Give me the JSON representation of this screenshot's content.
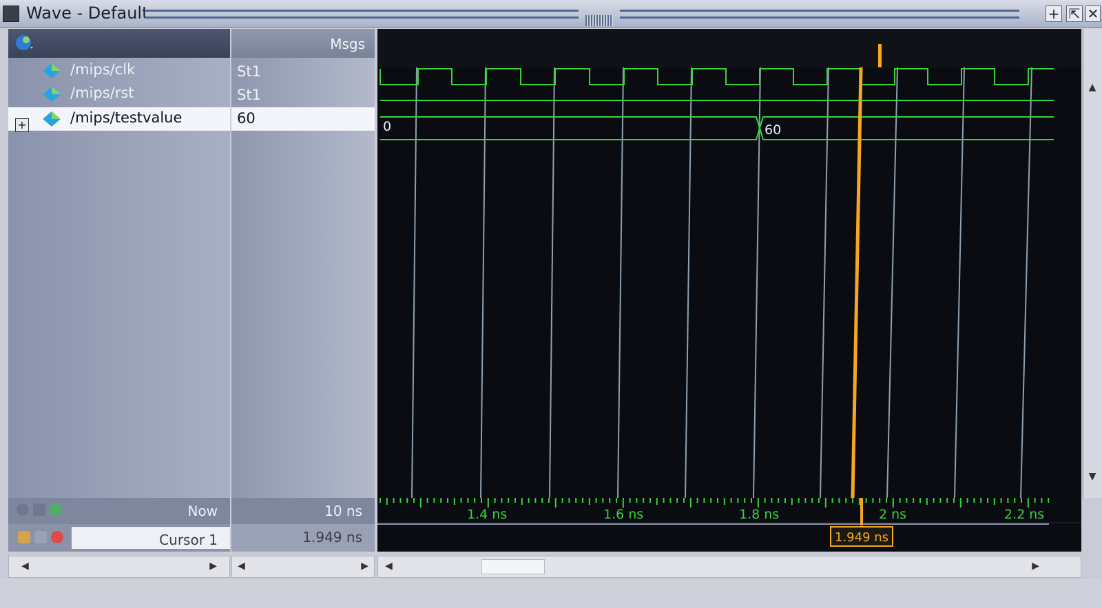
{
  "window": {
    "title": "Wave - Default"
  },
  "title_buttons": [
    "+",
    "⇱",
    "✕"
  ],
  "columns": {
    "messages_header": "Msgs"
  },
  "signals": [
    {
      "name": "/mips/clk",
      "value": "St1",
      "selected": false
    },
    {
      "name": "/mips/rst",
      "value": "St1",
      "selected": false
    },
    {
      "name": "/mips/testvalue",
      "value": "60",
      "selected": true,
      "expandable": true
    }
  ],
  "expand_symbol": "+",
  "bus_values": {
    "before": "0",
    "after": "60"
  },
  "status": {
    "now_label": "Now",
    "now_value": "10 ns",
    "cursor_label": "Cursor 1",
    "cursor_value": "1.949 ns",
    "cursor_marker_label": "1.949 ns"
  },
  "time_ticks": [
    "1.4 ns",
    "1.6 ns",
    "1.8 ns",
    "2 ns",
    "2.2 ns"
  ],
  "colors": {
    "wave": "#3ad13a",
    "cursor": "#f5a623",
    "background": "#0b0c12"
  },
  "icons": [
    "wave-window-icon",
    "signal-diamond-icon",
    "lock-icon",
    "remove-cursor-icon",
    "add-cursor-icon"
  ]
}
